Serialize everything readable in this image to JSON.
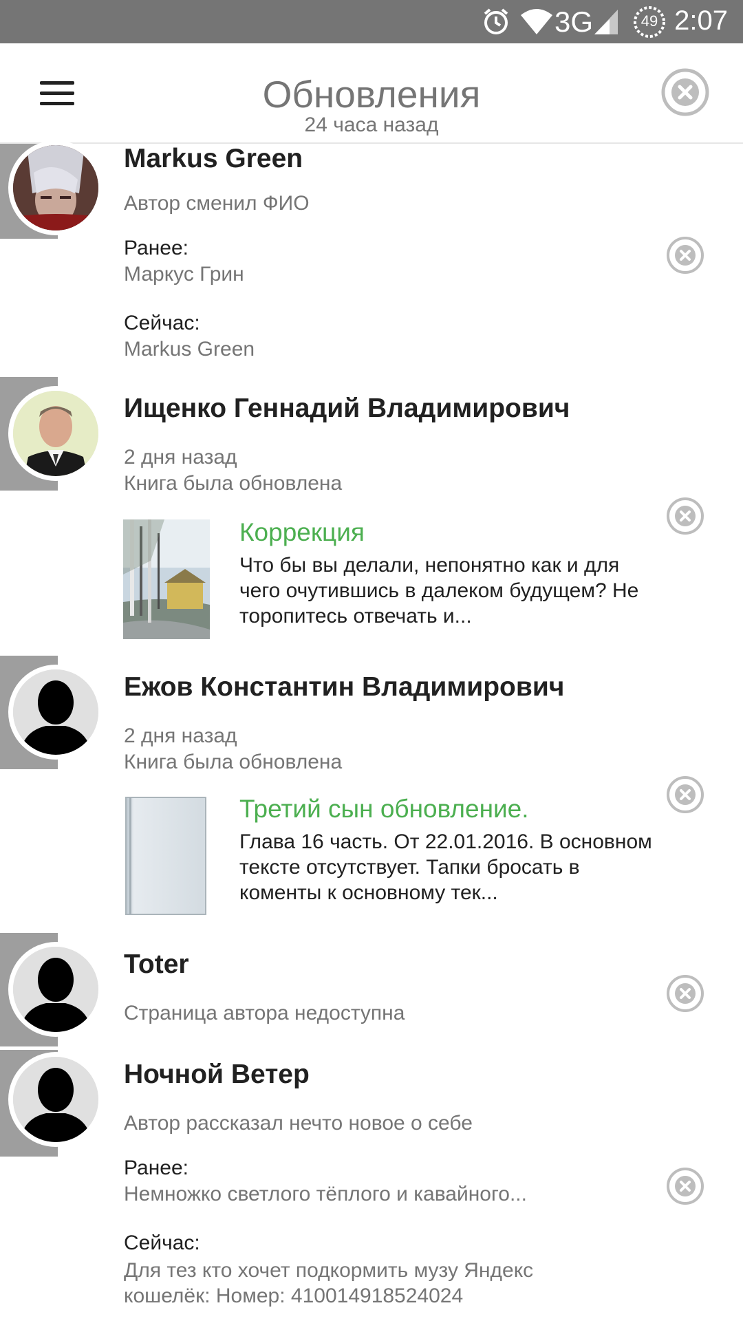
{
  "status_bar": {
    "network": "3G",
    "battery": "49",
    "time": "2:07",
    "icons": [
      "alarm-icon",
      "wifi-icon",
      "signal-icon",
      "battery-icon"
    ]
  },
  "header": {
    "title": "Обновления",
    "subtitle": "24 часа назад",
    "menu_icon": "hamburger-icon",
    "close_icon": "close-circle-icon"
  },
  "feed": [
    {
      "author": "Markus Green",
      "status": "Автор сменил ФИО",
      "before_label": "Ранее:",
      "before_value": "Маркус Грин",
      "now_label": "Сейчас:",
      "now_value": "Markus Green"
    },
    {
      "author": "Ищенко Геннадий Владимирович",
      "time": "2 дня назад",
      "status": "Книга была обновлена",
      "book_title": "Коррекция",
      "book_desc": "Что бы вы делали, непонятно как и для чего очутившись в далеком будущем? Не торопитесь отвечать и..."
    },
    {
      "author": "Ежов Константин Владимирович",
      "time": "2 дня назад",
      "status": "Книга была обновлена",
      "book_title": "Третий сын обновление.",
      "book_desc": "Глава 16 часть. От 22.01.2016. В основном тексте отсутствует. Тапки бросать в коменты к основному тек..."
    },
    {
      "author": "Toter",
      "status": "Страница автора недоступна"
    },
    {
      "author": "Ночной Ветер",
      "status": "Автор рассказал нечто новое о себе",
      "before_label": "Ранее:",
      "before_value": "Немножко светлого тёплого и кавайного...",
      "now_label": "Сейчас:",
      "now_value": "Для тез кто хочет подкормить музу Яндекс кошелёк: Номер: 410014918524024"
    }
  ],
  "colors": {
    "status_bar": "#757575",
    "accent_green": "#4caf50",
    "secondary_text": "#757575",
    "tab_gray": "#9e9e9e"
  }
}
